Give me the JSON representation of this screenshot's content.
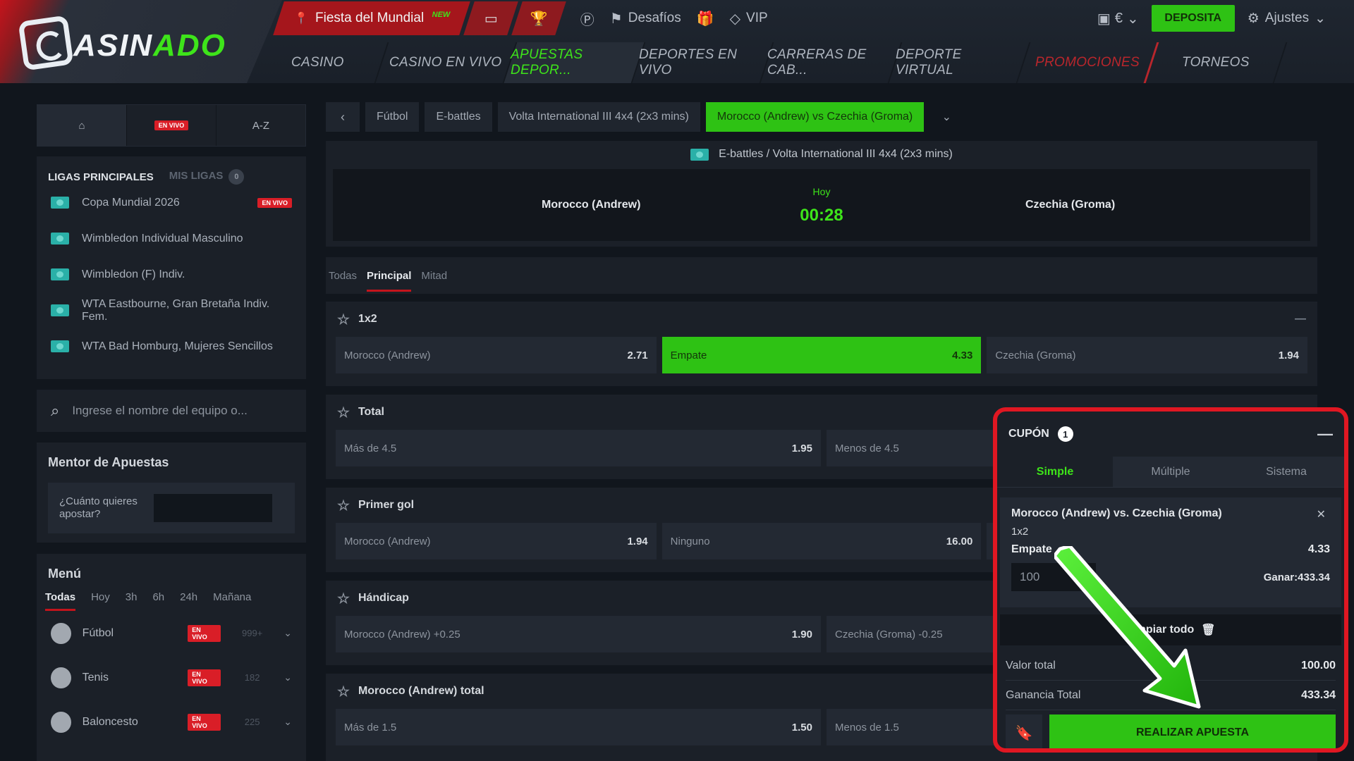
{
  "brand": {
    "logo_text_a": "C",
    "logo_text_b": "ASIN",
    "logo_text_c": "ADO"
  },
  "top_bar": {
    "promo_label": "Fiesta del Mundial",
    "promo_badge": "NEW",
    "challenges": "Desafíos",
    "vip": "VIP",
    "currency": "€",
    "deposit": "DEPOSITA",
    "settings": "Ajustes"
  },
  "nav": [
    "CASINO",
    "CASINO EN VIVO",
    "APUESTAS DEPOR...",
    "DEPORTES EN VIVO",
    "CARRERAS DE CAB...",
    "DEPORTE VIRTUAL",
    "PROMOCIONES",
    "TORNEOS"
  ],
  "sidebar": {
    "tabs": {
      "live": "EN VIVO",
      "az": "A-Z"
    },
    "leagues_title": "LIGAS PRINCIPALES",
    "my_leagues": "MIS LIGAS",
    "my_leagues_count": "0",
    "leagues": [
      {
        "name": "Copa Mundial 2026",
        "live": "EN VIVO"
      },
      {
        "name": "Wimbledon Individual Masculino",
        "live": ""
      },
      {
        "name": "Wimbledon (F) Indiv.",
        "live": ""
      },
      {
        "name": "WTA Eastbourne, Gran Bretaña Indiv. Fem.",
        "live": ""
      },
      {
        "name": "WTA Bad Homburg, Mujeres Sencillos",
        "live": ""
      }
    ],
    "search_placeholder": "Ingrese el nombre del equipo o...",
    "mentor_title": "Mentor de Apuestas",
    "mentor_question": "¿Cuánto quieres apostar?",
    "menu_title": "Menú",
    "menu_tabs": [
      "Todas",
      "Hoy",
      "3h",
      "6h",
      "24h",
      "Mañana"
    ],
    "sports": [
      {
        "name": "Fútbol",
        "live": "EN VIVO",
        "count": "999+"
      },
      {
        "name": "Tenis",
        "live": "EN VIVO",
        "count": "182"
      },
      {
        "name": "Baloncesto",
        "live": "EN VIVO",
        "count": "225"
      }
    ]
  },
  "breadcrumb": [
    "Fútbol",
    "E-battles",
    "Volta International III 4x4 (2x3 mins)",
    "Morocco (Andrew)  vs  Czechia (Groma)"
  ],
  "event": {
    "league": "E-battles / Volta International III 4x4 (2x3 mins)",
    "home": "Morocco (Andrew)",
    "away": "Czechia (Groma)",
    "day": "Hoy",
    "time": "00:28"
  },
  "market_tabs": [
    "Todas",
    "Principal",
    "Mitad"
  ],
  "markets": [
    {
      "title": "1x2",
      "odds": [
        {
          "label": "Morocco (Andrew)",
          "value": "2.71"
        },
        {
          "label": "Empate",
          "value": "4.33"
        },
        {
          "label": "Czechia (Groma)",
          "value": "1.94"
        }
      ]
    },
    {
      "title": "Total",
      "odds": [
        {
          "label": "Más de 4.5",
          "value": "1.95"
        },
        {
          "label": "Menos de 4.5",
          "value": ""
        }
      ]
    },
    {
      "title": "Primer gol",
      "odds": [
        {
          "label": "Morocco (Andrew)",
          "value": "1.94"
        },
        {
          "label": "Ninguno",
          "value": "16.00"
        }
      ]
    },
    {
      "title": "Hándicap",
      "odds": [
        {
          "label": "Morocco (Andrew) +0.25",
          "value": "1.90"
        },
        {
          "label": "Czechia (Groma) -0.25",
          "value": ""
        }
      ]
    },
    {
      "title": "Morocco (Andrew) total",
      "odds": [
        {
          "label": "Más de 1.5",
          "value": "1.50"
        },
        {
          "label": "Menos de 1.5",
          "value": ""
        }
      ]
    }
  ],
  "coupon": {
    "title": "CUPÓN",
    "count": "1",
    "tabs": [
      "Simple",
      "Múltiple",
      "Sistema"
    ],
    "match": "Morocco (Andrew) vs. Czechia (Groma)",
    "market": "1x2",
    "pick": "Empate",
    "odd": "4.33",
    "stake": "100",
    "win_label": "Ganar:",
    "win_value": "433.34",
    "clear": "Limpiar todo",
    "total_label": "Valor total",
    "total_value": "100.00",
    "gain_label": "Ganancia Total",
    "gain_value": "433.34",
    "place": "REALIZAR APUESTA"
  },
  "colors": {
    "accent_green": "#2ec214",
    "brand_red": "#c4141c",
    "highlight_border": "#e01722"
  }
}
